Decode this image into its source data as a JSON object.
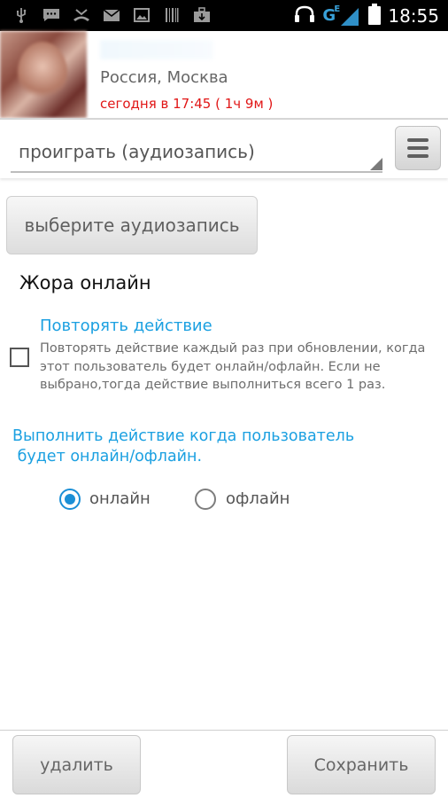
{
  "status_bar": {
    "time": "18:55",
    "network": "G",
    "network_sub": "E",
    "icons": [
      "usb-icon",
      "chat-icon",
      "missed-call-icon",
      "email-icon",
      "image-icon",
      "barcode-icon",
      "briefcase-icon",
      "headphones-icon",
      "signal-icon",
      "battery-icon"
    ]
  },
  "profile": {
    "name": "",
    "location": "Россия, Москва",
    "status": "сегодня в 17:45 ( 1ч 9м  )"
  },
  "action": {
    "selected": "проиграть (аудиозапись)"
  },
  "audio_button": "выберите аудиозапись",
  "title": "Жора онлайн",
  "repeat": {
    "title": "Повторять действие",
    "description": "Повторять действие каждый раз при обновлении, когда этот пользователь будет онлайн/офлайн. Если не выбрано,тогда действие выполниться всего 1 раз.",
    "checked": false
  },
  "when": {
    "label_line1": "Выполнить действие когда пользователь",
    "label_line2": " будет онлайн/офлайн.",
    "options": [
      {
        "label": "онлайн",
        "selected": true
      },
      {
        "label": "офлайн",
        "selected": false
      }
    ]
  },
  "buttons": {
    "delete": "удалить",
    "save": "Сохранить"
  },
  "colors": {
    "accent": "#1ba0e1",
    "status_red": "#e11616",
    "radio_on": "#1b8fd6"
  }
}
